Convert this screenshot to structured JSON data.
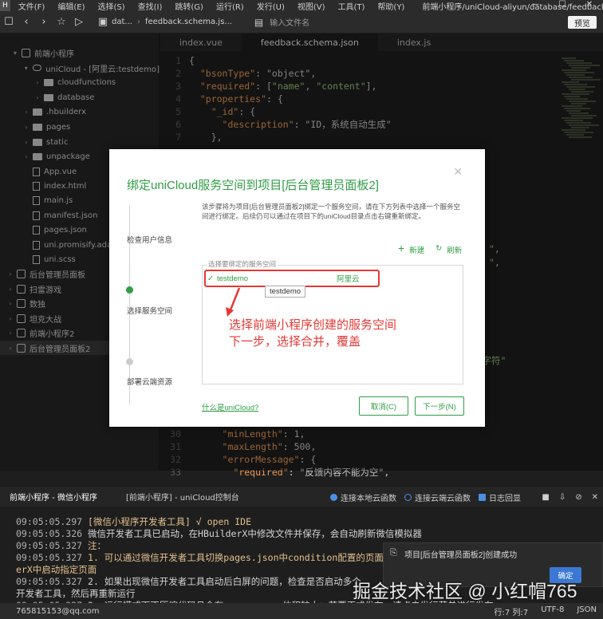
{
  "menubar": {
    "items": [
      "文件(F)",
      "编辑(E)",
      "选择(S)",
      "查找(I)",
      "跳转(G)",
      "运行(R)",
      "发行(U)",
      "视图(V)",
      "工具(T)",
      "帮助(Y)"
    ],
    "path": "前端小程序/uniCloud-aliyun/database/feedback.s..."
  },
  "toolbar": {
    "crumbs": [
      "dat...",
      "feedback.schema.js..."
    ],
    "search_placeholder": "输入文件名",
    "preview_label": "预览"
  },
  "sidebar": {
    "items": [
      {
        "label": "前端小程序",
        "icon": "project",
        "arrow": "▾"
      },
      {
        "label": "uniCloud - [阿里云:testdemo]",
        "icon": "cloud",
        "arrow": "▾"
      },
      {
        "label": "cloudfunctions",
        "icon": "folder",
        "arrow": "›"
      },
      {
        "label": "database",
        "icon": "folder",
        "arrow": "›"
      },
      {
        "label": ".hbuilderx",
        "icon": "folder",
        "arrow": "›"
      },
      {
        "label": "pages",
        "icon": "folder",
        "arrow": "›"
      },
      {
        "label": "static",
        "icon": "folder",
        "arrow": "›"
      },
      {
        "label": "unpackage",
        "icon": "folder",
        "arrow": "›"
      },
      {
        "label": "App.vue",
        "icon": "file",
        "arrow": ""
      },
      {
        "label": "index.html",
        "icon": "file",
        "arrow": ""
      },
      {
        "label": "main.js",
        "icon": "file",
        "arrow": ""
      },
      {
        "label": "manifest.json",
        "icon": "file",
        "arrow": ""
      },
      {
        "label": "pages.json",
        "icon": "file",
        "arrow": ""
      },
      {
        "label": "uni.promisify.adaptor.js",
        "icon": "file",
        "arrow": ""
      },
      {
        "label": "uni.scss",
        "icon": "file",
        "arrow": ""
      },
      {
        "label": "后台管理员面板",
        "icon": "project",
        "arrow": "›"
      },
      {
        "label": "扫雷游戏",
        "icon": "project",
        "arrow": "›"
      },
      {
        "label": "数独",
        "icon": "project",
        "arrow": "›"
      },
      {
        "label": "坦克大战",
        "icon": "project",
        "arrow": "›"
      },
      {
        "label": "前端小程序2",
        "icon": "project",
        "arrow": "›"
      },
      {
        "label": "后台管理员面板2",
        "icon": "project",
        "arrow": "›"
      }
    ]
  },
  "tabs": [
    "index.vue",
    "feedback.schema.json",
    "index.js"
  ],
  "editor": {
    "lines": [
      {
        "n": "1",
        "code": "{"
      },
      {
        "n": "2",
        "code": "  \"bsonType\": \"object\","
      },
      {
        "n": "3",
        "code": "  \"required\": [\"name\", \"content\"],"
      },
      {
        "n": "4",
        "code": "  \"properties\": {"
      },
      {
        "n": "5",
        "code": "    \"_id\": {"
      },
      {
        "n": "6",
        "code": "      \"description\": \"ID，系统自动生成\""
      },
      {
        "n": "7",
        "code": "    },"
      },
      {
        "n": "30",
        "code": "      \"minLength\": 1,"
      },
      {
        "n": "31",
        "code": "      \"maxLength\": 500,"
      },
      {
        "n": "32",
        "code": "      \"errorMessage\": {"
      },
      {
        "n": "33",
        "code": "        \"required\": \"反馈内容不能为空\","
      }
    ],
    "behind_dialog": [
      "\",",
      "\",",
      "个字符\""
    ]
  },
  "dialog": {
    "title": "绑定uniCloud服务空间到项目[后台管理员面板2]",
    "description": "该步骤将为项目[后台管理员面板2]绑定一个服务空间，请在下方列表中选择一个服务空间进行绑定。后续仍可以通过在项目下的uniCloud目录点击右键重新绑定。",
    "steps": [
      "检查用户信息",
      "选择服务空间",
      "部署云端资源"
    ],
    "new_label": "新建",
    "refresh_label": "刷新",
    "list_label": "选择要绑定的服务空间",
    "space": {
      "name": "testdemo",
      "provider": "阿里云"
    },
    "tooltip": "testdemo",
    "annotation": [
      "选择前端小程序创建的服务空间",
      "下一步，选择合并，覆盖"
    ],
    "help_link": "什么是uniCloud?",
    "cancel_label": "取消(C)",
    "next_label": "下一步(N)",
    "annotation_color": "#e53935",
    "accent_color": "#2f9e44"
  },
  "bottom": {
    "tabs": [
      "前端小程序 - 微信小程序",
      "[前端小程序] - uniCloud控制台"
    ],
    "options": [
      "连接本地云函数",
      "连接云端云函数",
      "日志回显"
    ]
  },
  "console": [
    {
      "ts": "09:05:05.297",
      "msg": "[微信小程序开发者工具] √ open IDE",
      "style": "y"
    },
    {
      "ts": "09:05:05.326",
      "msg": "微信开发者工具已启动，在HBuilderX中修改文件并保存，会自动刷新微信模拟器",
      "style": "w"
    },
    {
      "ts": "09:05:05.327",
      "msg": "注：",
      "style": "y"
    },
    {
      "ts": "09:05:05.327",
      "msg": "1. 可以通过微信开发者工具切换pages.json中condition配置的页面，或者关闭微信开发者工具，然后再从HBuild",
      "style": "y"
    },
    {
      "ts": "",
      "msg": "erX中启动指定页面",
      "style": "y"
    },
    {
      "ts": "09:05:05.327",
      "msg": "2. 如果出现微信开发者工具启动后白屏的问题，检查是否启动多个",
      "style": "w"
    },
    {
      "ts": "",
      "msg": "开发者工具，然后再重新运行",
      "style": "w"
    },
    {
      "ts": "09:05:05.327",
      "msg": "3. 运行模式下不压缩代码且含有sourcemap，体积较大；若要正式发布，请点击发行菜单进行发布",
      "style": "w"
    }
  ],
  "toast": {
    "message": "项目[后台管理员面板2]创建成功",
    "ok_label": "确定"
  },
  "statusbar": {
    "user": "765815153@qq.com",
    "position": "行:7  列:7",
    "encoding": "UTF-8",
    "language": "JSON"
  },
  "watermark": "掘金技术社区 @ 小红帽765"
}
